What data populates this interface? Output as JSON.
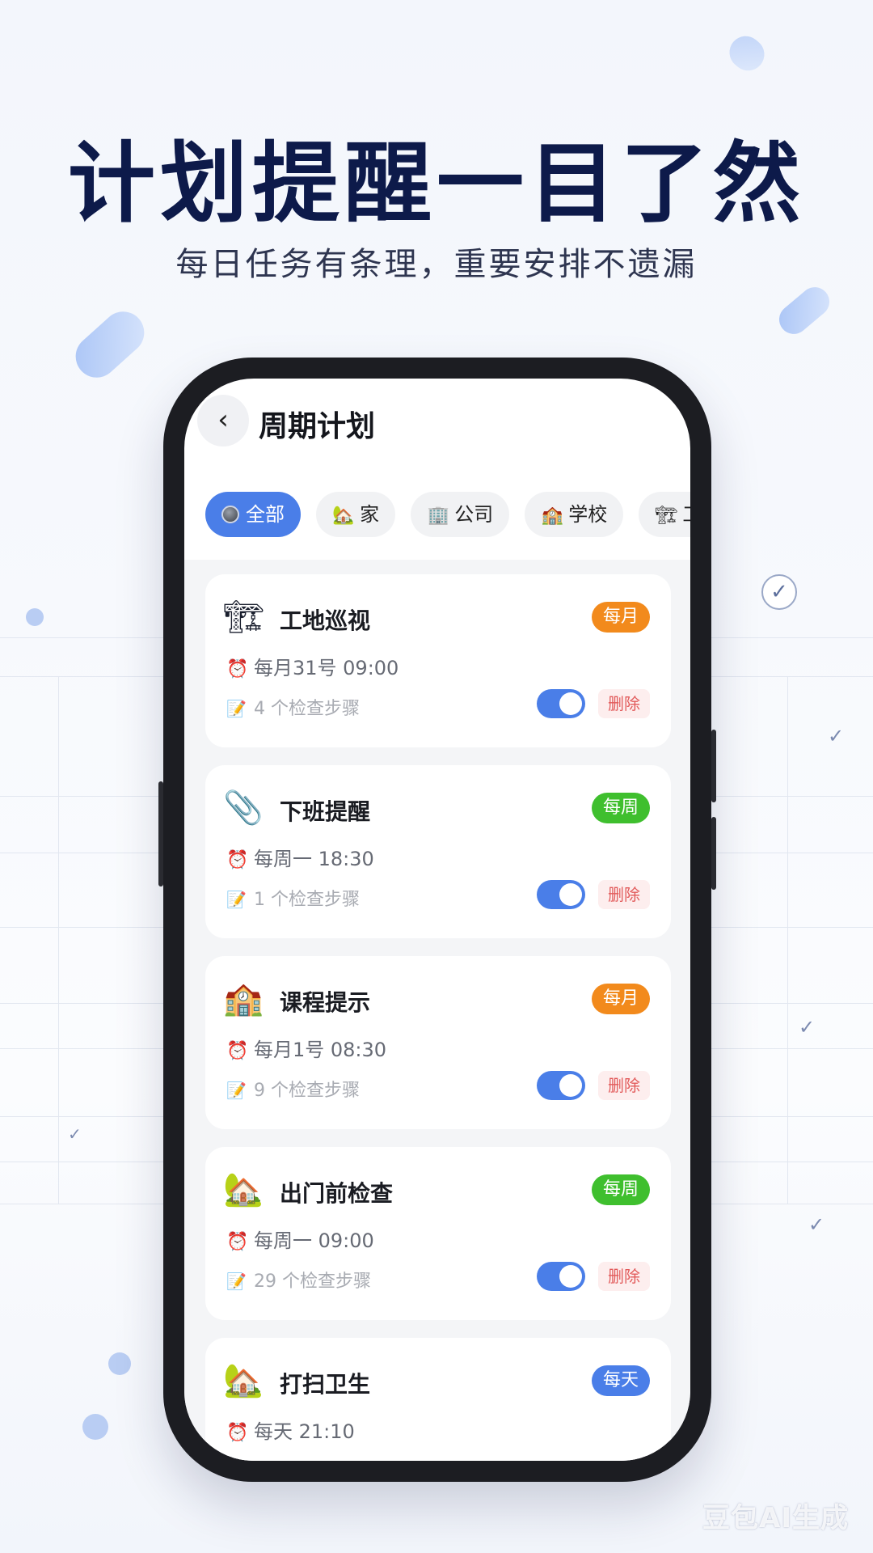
{
  "headline": "计划提醒一目了然",
  "subline": "每日任务有条理，重要安排不遗漏",
  "app": {
    "back_icon": "chevron-left-icon",
    "title": "周期计划",
    "tabs": [
      {
        "label": "全部",
        "icon": "all-dot-icon",
        "active": true
      },
      {
        "label": "家",
        "icon": "house-icon",
        "glyph": "🏡",
        "active": false
      },
      {
        "label": "公司",
        "icon": "office-icon",
        "glyph": "🏢",
        "active": false
      },
      {
        "label": "学校",
        "icon": "school-icon",
        "glyph": "🏫",
        "active": false
      },
      {
        "label": "工",
        "icon": "construction-icon",
        "glyph": "🏗",
        "active": false
      }
    ],
    "plans": [
      {
        "title": "工地巡视",
        "icon": "crane-icon",
        "glyph": "🏗",
        "frequency": "每月",
        "freq_color": "#f28a1c",
        "time": "每月31号 09:00",
        "steps": "4 个检查步骤",
        "delete_label": "删除",
        "enabled": true
      },
      {
        "title": "下班提醒",
        "icon": "paperclip-icon",
        "glyph": "📎",
        "frequency": "每周",
        "freq_color": "#3fbf2e",
        "time": "每周一 18:30",
        "steps": "1 个检查步骤",
        "delete_label": "删除",
        "enabled": true
      },
      {
        "title": "课程提示",
        "icon": "school-icon",
        "glyph": "🏫",
        "frequency": "每月",
        "freq_color": "#f28a1c",
        "time": "每月1号 08:30",
        "steps": "9 个检查步骤",
        "delete_label": "删除",
        "enabled": true
      },
      {
        "title": "出门前检查",
        "icon": "house-icon",
        "glyph": "🏡",
        "frequency": "每周",
        "freq_color": "#3fbf2e",
        "time": "每周一 09:00",
        "steps": "29 个检查步骤",
        "delete_label": "删除",
        "enabled": true
      },
      {
        "title": "打扫卫生",
        "icon": "house-icon",
        "glyph": "🏡",
        "frequency": "每天",
        "freq_color": "#4a7ee8",
        "time": "每天 21:10"
      }
    ]
  },
  "colors": {
    "accent": "#4a7ee8",
    "headline": "#0d1a4a",
    "delete": "#e25a5a"
  },
  "watermark": "豆包AI生成"
}
